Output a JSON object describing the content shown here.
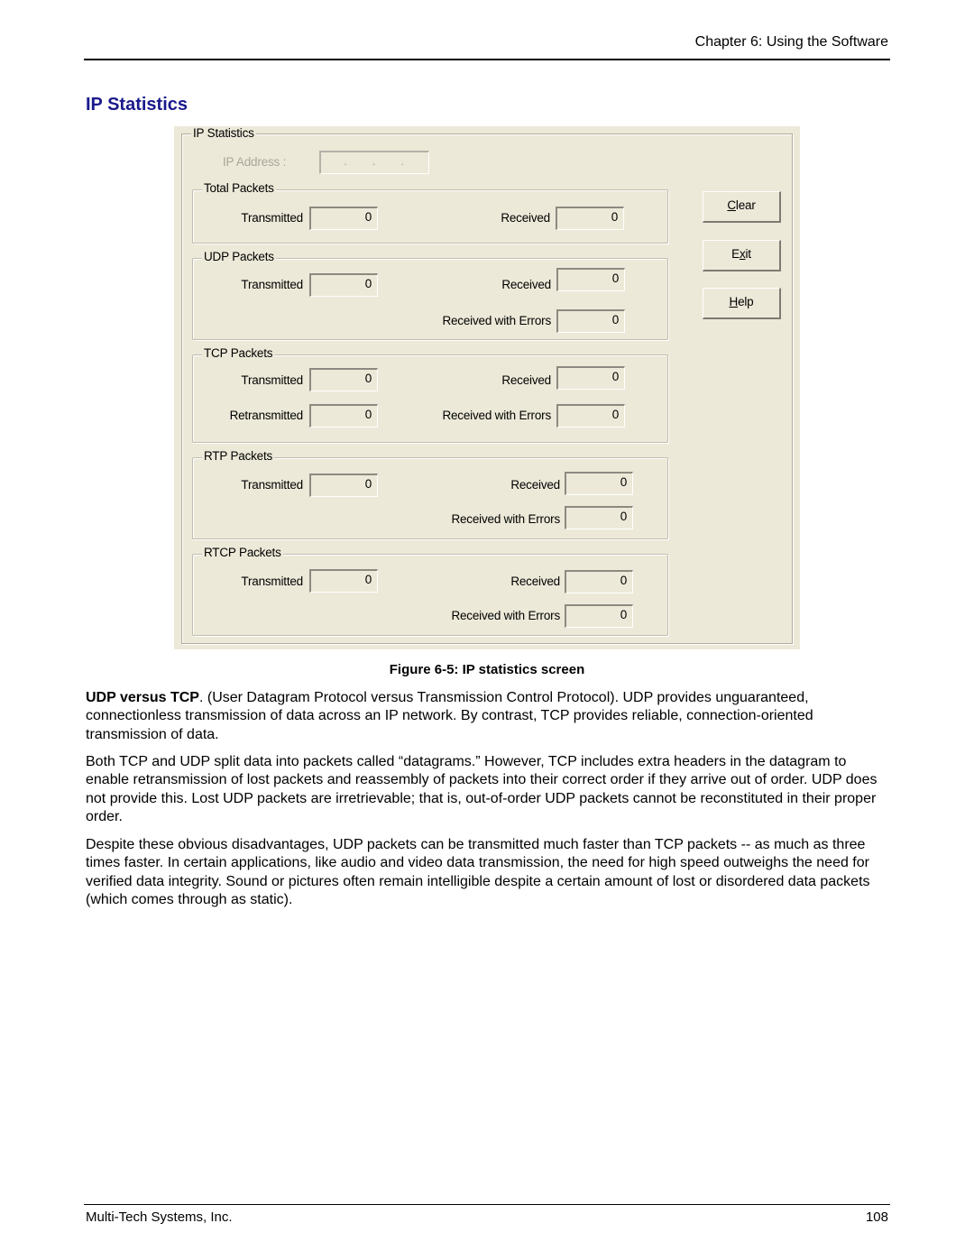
{
  "header": {
    "chapter": "Chapter 6: Using the Software"
  },
  "section_title": "IP Statistics",
  "dialog": {
    "title": "IP Statistics",
    "ip_address": {
      "label": "IP Address :",
      "value": ". . ."
    },
    "groups": {
      "total": {
        "title": "Total Packets",
        "transmitted_label": "Transmitted",
        "transmitted": "0",
        "received_label": "Received",
        "received": "0"
      },
      "udp": {
        "title": "UDP Packets",
        "transmitted_label": "Transmitted",
        "transmitted": "0",
        "received_label": "Received",
        "received": "0",
        "errors_label": "Received with Errors",
        "errors": "0"
      },
      "tcp": {
        "title": "TCP Packets",
        "transmitted_label": "Transmitted",
        "transmitted": "0",
        "received_label": "Received",
        "received": "0",
        "retransmitted_label": "Retransmitted",
        "retransmitted": "0",
        "errors_label": "Received with Errors",
        "errors": "0"
      },
      "rtp": {
        "title": "RTP Packets",
        "transmitted_label": "Transmitted",
        "transmitted": "0",
        "received_label": "Received",
        "received": "0",
        "errors_label": "Received with Errors",
        "errors": "0"
      },
      "rtcp": {
        "title": "RTCP Packets",
        "transmitted_label": "Transmitted",
        "transmitted": "0",
        "received_label": "Received",
        "received": "0",
        "errors_label": "Received with Errors",
        "errors": "0"
      }
    },
    "buttons": {
      "clear": {
        "pre": "",
        "accel": "C",
        "post": "lear"
      },
      "exit": {
        "pre": "E",
        "accel": "x",
        "post": "it"
      },
      "help": {
        "pre": "",
        "accel": "H",
        "post": "elp"
      }
    }
  },
  "caption": "Figure 6-5: IP statistics screen",
  "paragraphs": {
    "p1_lead": "UDP versus TCP",
    "p1_rest": ".  (User Datagram Protocol versus Transmission Control Protocol).  UDP provides unguaranteed, connectionless transmission of data across an IP network. By contrast, TCP provides reliable, connection-oriented transmission of data.",
    "p2": "Both TCP and UDP split data into packets called “datagrams.”  However, TCP includes extra headers in the datagram to enable retransmission of lost packets and reassembly of packets into their correct order if they arrive out of order.  UDP does not provide this.  Lost UDP packets are irretrievable; that is, out-of-order UDP packets cannot be reconstituted in their proper order.",
    "p3": "Despite these obvious disadvantages, UDP packets can be transmitted much faster than TCP packets -- as much as three times faster. In certain applications, like audio and video data transmission, the need for high speed outweighs the need for verified data integrity.  Sound or pictures often remain intelligible despite a certain amount of lost or disordered data packets (which comes through as static)."
  },
  "footer": {
    "company": "Multi-Tech Systems, Inc.",
    "page": "108"
  }
}
